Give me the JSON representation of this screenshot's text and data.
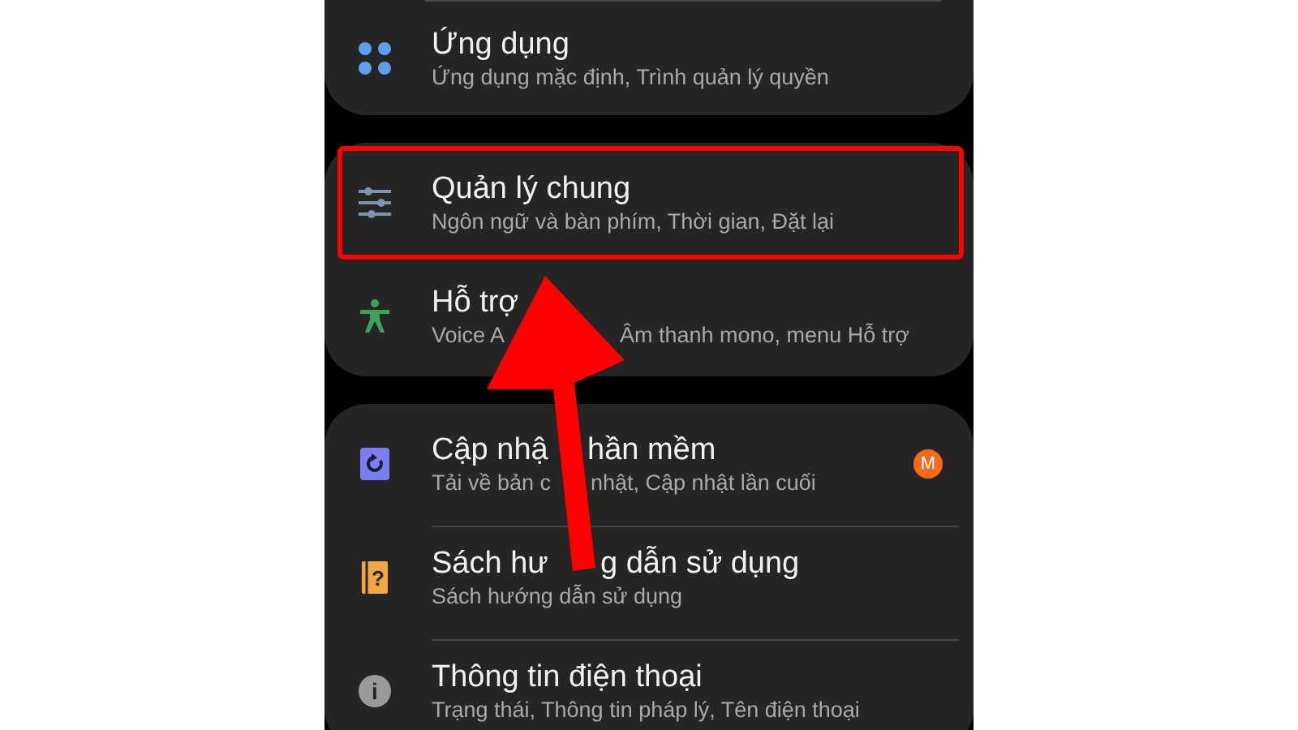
{
  "groups": [
    {
      "cut_top": true,
      "dividers": true,
      "items": [
        {
          "kind": "apps",
          "title": [
            "Ứng dụng"
          ],
          "subtitle": [
            "Ứng dụng mặc định, Trình quản lý quyền"
          ],
          "highlighted": false
        }
      ]
    },
    {
      "cut_top": false,
      "dividers": false,
      "items": [
        {
          "kind": "sliders",
          "title": [
            "Quản lý chung"
          ],
          "subtitle": [
            "Ngôn ngữ và bàn phím, Thời gian, Đặt lại"
          ],
          "highlighted": true
        },
        {
          "kind": "accessibility",
          "title": [
            "Hỗ trợ"
          ],
          "subtitle": [
            "Voice A",
            "Âm thanh mono, menu Hỗ trợ"
          ],
          "highlighted": false
        }
      ]
    },
    {
      "cut_top": false,
      "dividers": true,
      "items": [
        {
          "kind": "update",
          "title": [
            "Cập nhậ",
            "hần mềm"
          ],
          "subtitle": [
            "Tải về bản c",
            "nhật, Cập nhật lần cuối"
          ],
          "badge": "M",
          "highlighted": false
        },
        {
          "kind": "manual",
          "glyph": "?",
          "title": [
            "Sách hư",
            "g dẫn sử dụng"
          ],
          "subtitle": [
            "Sách hướng dẫn sử dụng"
          ],
          "highlighted": false
        },
        {
          "kind": "info",
          "glyph": "i",
          "title": [
            "Thông tin điện thoại"
          ],
          "subtitle": [
            "Trạng thái, Thông tin pháp lý, Tên điện thoại"
          ],
          "highlighted": false
        }
      ]
    }
  ]
}
